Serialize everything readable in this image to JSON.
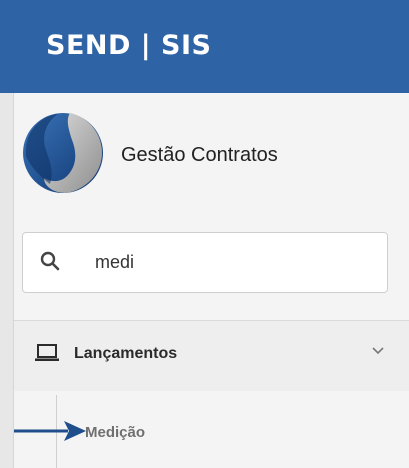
{
  "header": {
    "title": "SEND | SIS"
  },
  "brand": {
    "name": "Gestão Contratos",
    "logo_icon": "brand-logo-icon"
  },
  "search": {
    "value": "medi",
    "icon": "search-icon"
  },
  "menu": {
    "section": {
      "label": "Lançamentos",
      "icon": "laptop-icon",
      "chevron": "chevron-down-icon"
    },
    "items": [
      {
        "label": "Medição"
      }
    ]
  },
  "annotation": {
    "icon": "arrow-right-icon"
  },
  "colors": {
    "header": "#2e63a6",
    "sidebar": "#f4f4f4",
    "arrow": "#1f4e8c"
  }
}
